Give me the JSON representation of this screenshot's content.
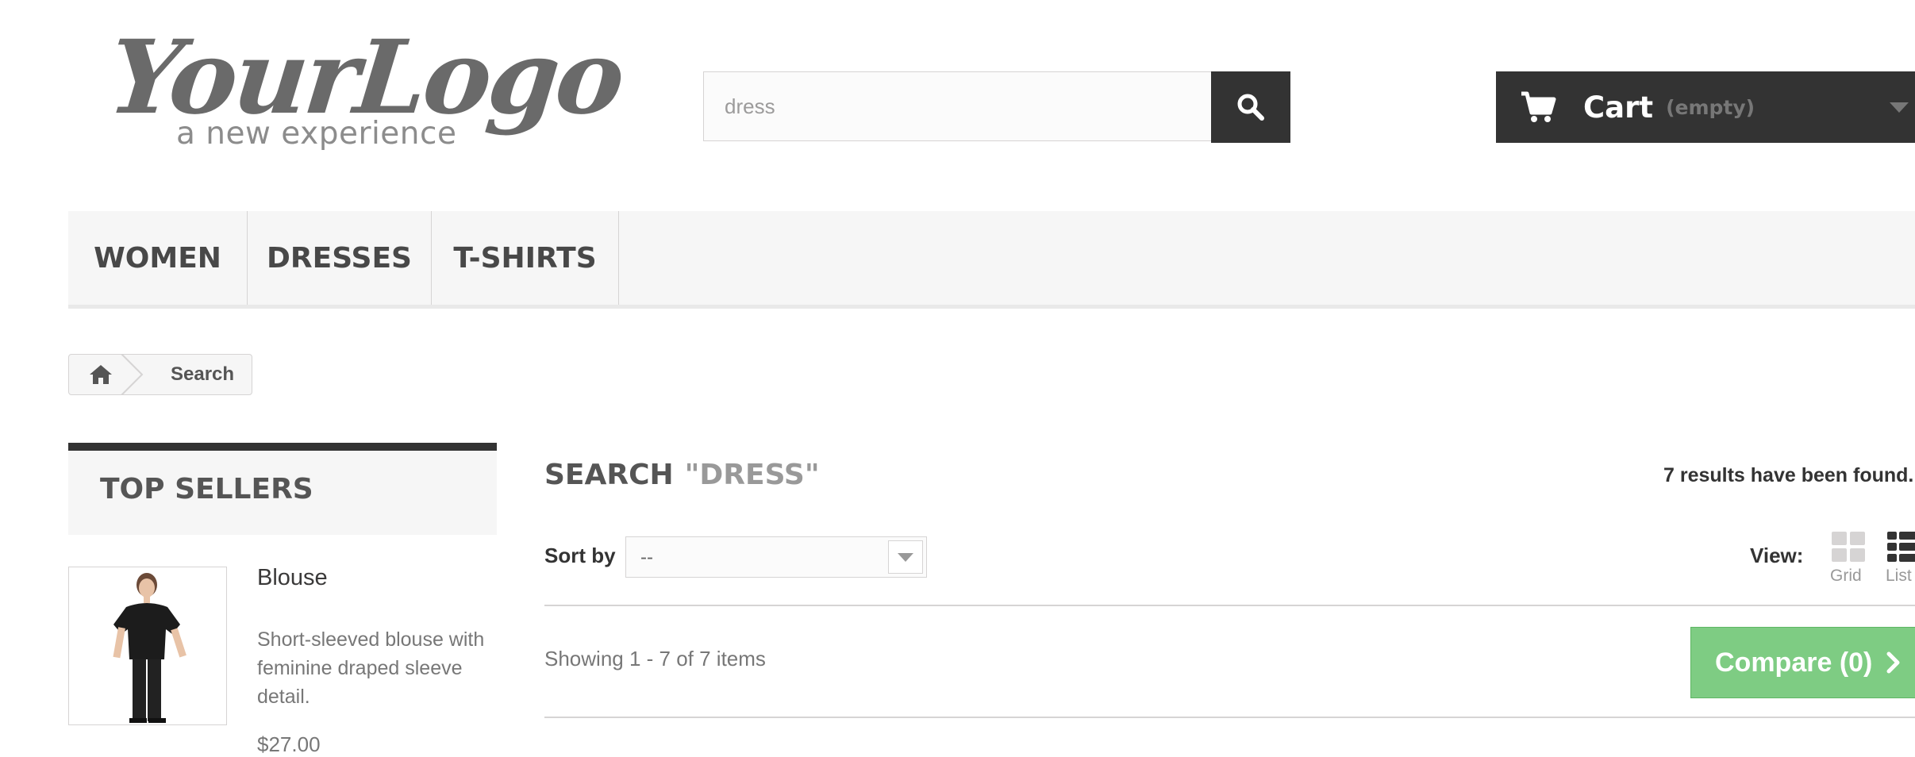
{
  "header": {
    "logo": {
      "main": "YourLogo",
      "tagline": "a new experience"
    },
    "search": {
      "value": "dress"
    },
    "cart": {
      "label": "Cart",
      "status": "(empty)"
    }
  },
  "menu": {
    "items": [
      "WOMEN",
      "DRESSES",
      "T-SHIRTS"
    ]
  },
  "breadcrumb": {
    "current": "Search"
  },
  "sidebar": {
    "top_sellers_title": "TOP SELLERS",
    "product": {
      "name": "Blouse",
      "description": "Short-sleeved blouse with feminine draped sleeve detail.",
      "price": "$27.00"
    }
  },
  "main": {
    "title_prefix": "SEARCH",
    "title_term": "\"DRESS\"",
    "results_count": "7 results have been found.",
    "sort": {
      "label": "Sort by",
      "selected": "--"
    },
    "view": {
      "label": "View:",
      "grid_label": "Grid",
      "list_label": "List"
    },
    "showing": "Showing 1 - 7 of 7 items",
    "compare": "Compare (0)"
  },
  "colors": {
    "dark": "#333333",
    "compare_green": "#7ecc83",
    "menu_bg": "#f6f6f6"
  },
  "icons": [
    "search-icon",
    "cart-icon",
    "home-icon",
    "grid-view-icon",
    "list-view-icon",
    "chevron-right-icon"
  ]
}
